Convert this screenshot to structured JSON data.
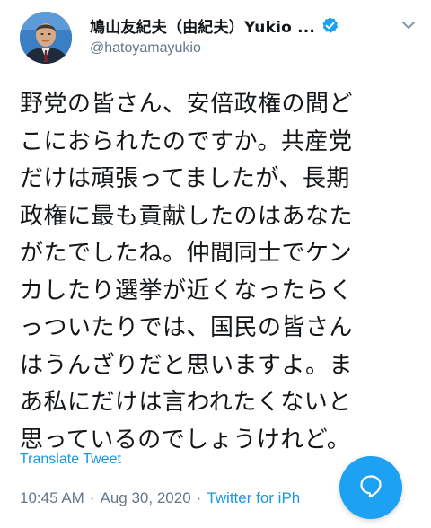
{
  "user": {
    "display_name": "鳩山友紀夫（由紀夫）Yukio ...",
    "handle": "@hatoyamayukio",
    "verified": true
  },
  "tweet": {
    "lines": [
      "野党の皆さん、安倍政権の間ど",
      "こにおられたのですか。共産党",
      "だけは頑張ってましたが、長期",
      "政権に最も貢献したのはあなた",
      "がたでしたね。仲間同士でケン",
      "カしたり選挙が近くなったらく",
      "っついたりでは、国民の皆さん",
      "はうんざりだと思いますよ。ま",
      "あ私にだけは言われたくないと",
      "思っているのでしょうけれど。"
    ]
  },
  "translate_label": "Translate Tweet",
  "meta": {
    "time": "10:45 AM",
    "date": "Aug 30, 2020",
    "separator": "·",
    "source": "Twitter for iPh"
  },
  "icons": {
    "verified": "verified-badge-icon",
    "chevron": "chevron-down-icon",
    "compose": "reply-bubble-icon"
  },
  "colors": {
    "accent": "#1da1f2",
    "link": "#1b95e0",
    "muted": "#657786",
    "text": "#14171a"
  }
}
